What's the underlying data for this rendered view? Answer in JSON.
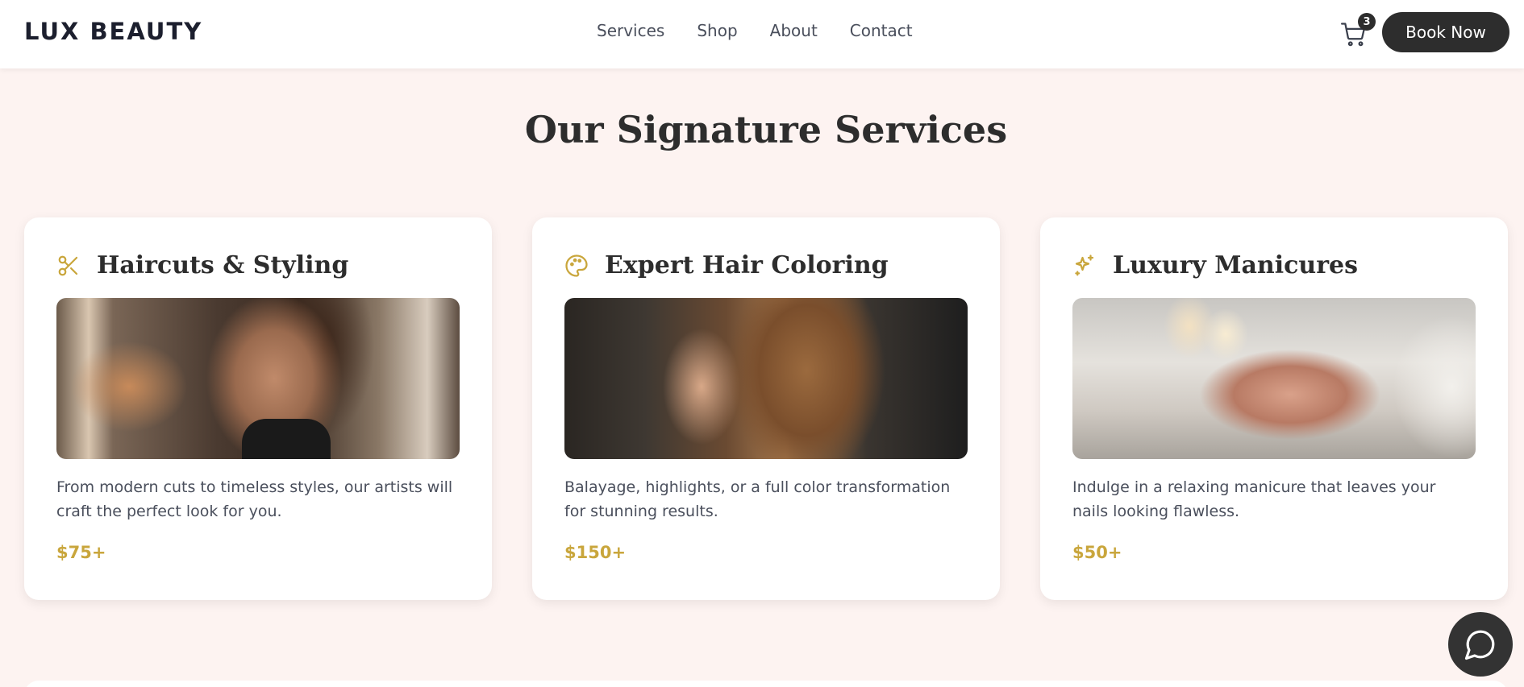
{
  "header": {
    "logo": "LUX BEAUTY",
    "nav": [
      "Services",
      "Shop",
      "About",
      "Contact"
    ],
    "cart_count": "3",
    "cta_label": "Book Now"
  },
  "section": {
    "title": "Our Signature Services"
  },
  "cards": [
    {
      "icon": "scissors-icon",
      "title": "Haircuts & Styling",
      "description": "From modern cuts to timeless styles, our artists will craft the perfect look for you.",
      "price": "$75+"
    },
    {
      "icon": "palette-icon",
      "title": "Expert Hair Coloring",
      "description": "Balayage, highlights, or a full color transformation for stunning results.",
      "price": "$150+"
    },
    {
      "icon": "sparkles-icon",
      "title": "Luxury Manicures",
      "description": "Indulge in a relaxing manicure that leaves your nails looking flawless.",
      "price": "$50+"
    }
  ],
  "colors": {
    "accent_gold": "#c9a63c",
    "dark": "#2d2d2d",
    "page_bg": "#fdf3f1"
  }
}
